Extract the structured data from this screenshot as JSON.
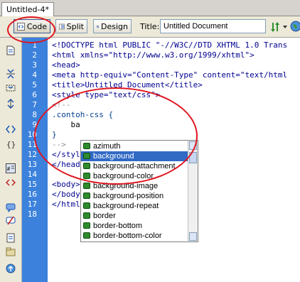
{
  "document_tab": "Untitled-4*",
  "toolbar": {
    "code_label": "Code",
    "split_label": "Split",
    "design_label": "Design",
    "title_label": "Title:",
    "title_value": "Untitled Document"
  },
  "line_numbers": [
    "1",
    "2",
    "3",
    "4",
    "5",
    "6",
    "7",
    "8",
    "9",
    "10",
    "11",
    "12",
    "13",
    "14",
    "15",
    "16",
    "17",
    "18"
  ],
  "code_lines": [
    {
      "cls": "tag",
      "text": "<!DOCTYPE html PUBLIC \"-//W3C//DTD XHTML 1.0 Trans"
    },
    {
      "cls": "tag",
      "text": "<html xmlns=\"http://www.w3.org/1999/xhtml\">"
    },
    {
      "cls": "tag",
      "text": "<head>"
    },
    {
      "cls": "tag",
      "text": "<meta http-equiv=\"Content-Type\" content=\"text/html"
    },
    {
      "cls": "tag",
      "text": "<title>Untitled Document</title>"
    },
    {
      "cls": "tag",
      "text": "<style type=\"text/css\">"
    },
    {
      "cls": "comment",
      "text": "<!--"
    },
    {
      "cls": "css",
      "text": ".contoh-css {"
    },
    {
      "cls": "plain",
      "text": "    ba"
    },
    {
      "cls": "css",
      "text": "}"
    },
    {
      "cls": "comment",
      "text": "-->"
    },
    {
      "cls": "tag",
      "text": "</style>"
    },
    {
      "cls": "tag",
      "text": "</head>"
    },
    {
      "cls": "plain",
      "text": ""
    },
    {
      "cls": "tag",
      "text": "<body>"
    },
    {
      "cls": "tag",
      "text": "</body>"
    },
    {
      "cls": "tag",
      "text": "</html>"
    },
    {
      "cls": "plain",
      "text": ""
    }
  ],
  "autocomplete": {
    "items": [
      "azimuth",
      "background",
      "background-attachment",
      "background-color",
      "background-image",
      "background-position",
      "background-repeat",
      "border",
      "border-bottom",
      "border-bottom-color"
    ],
    "selected_index": 1
  },
  "colors": {
    "gutter": "#3c82dc",
    "selection": "#316ac5",
    "annotation_ring": "#e0141e"
  }
}
